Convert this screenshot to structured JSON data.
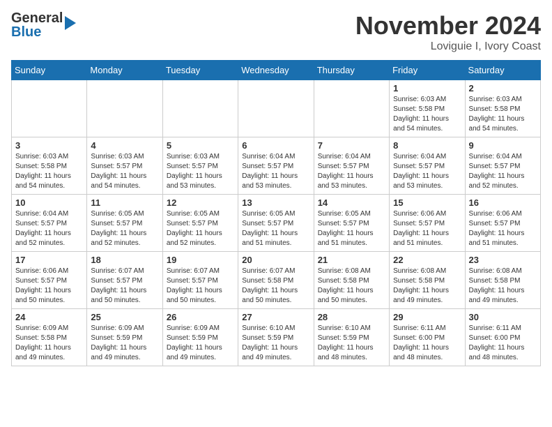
{
  "header": {
    "logo": {
      "line1": "General",
      "line2": "Blue"
    },
    "title": "November 2024",
    "location": "Loviguie I, Ivory Coast"
  },
  "calendar": {
    "days_of_week": [
      "Sunday",
      "Monday",
      "Tuesday",
      "Wednesday",
      "Thursday",
      "Friday",
      "Saturday"
    ],
    "weeks": [
      [
        {
          "day": "",
          "info": ""
        },
        {
          "day": "",
          "info": ""
        },
        {
          "day": "",
          "info": ""
        },
        {
          "day": "",
          "info": ""
        },
        {
          "day": "",
          "info": ""
        },
        {
          "day": "1",
          "info": "Sunrise: 6:03 AM\nSunset: 5:58 PM\nDaylight: 11 hours and 54 minutes."
        },
        {
          "day": "2",
          "info": "Sunrise: 6:03 AM\nSunset: 5:58 PM\nDaylight: 11 hours and 54 minutes."
        }
      ],
      [
        {
          "day": "3",
          "info": "Sunrise: 6:03 AM\nSunset: 5:58 PM\nDaylight: 11 hours and 54 minutes."
        },
        {
          "day": "4",
          "info": "Sunrise: 6:03 AM\nSunset: 5:57 PM\nDaylight: 11 hours and 54 minutes."
        },
        {
          "day": "5",
          "info": "Sunrise: 6:03 AM\nSunset: 5:57 PM\nDaylight: 11 hours and 53 minutes."
        },
        {
          "day": "6",
          "info": "Sunrise: 6:04 AM\nSunset: 5:57 PM\nDaylight: 11 hours and 53 minutes."
        },
        {
          "day": "7",
          "info": "Sunrise: 6:04 AM\nSunset: 5:57 PM\nDaylight: 11 hours and 53 minutes."
        },
        {
          "day": "8",
          "info": "Sunrise: 6:04 AM\nSunset: 5:57 PM\nDaylight: 11 hours and 53 minutes."
        },
        {
          "day": "9",
          "info": "Sunrise: 6:04 AM\nSunset: 5:57 PM\nDaylight: 11 hours and 52 minutes."
        }
      ],
      [
        {
          "day": "10",
          "info": "Sunrise: 6:04 AM\nSunset: 5:57 PM\nDaylight: 11 hours and 52 minutes."
        },
        {
          "day": "11",
          "info": "Sunrise: 6:05 AM\nSunset: 5:57 PM\nDaylight: 11 hours and 52 minutes."
        },
        {
          "day": "12",
          "info": "Sunrise: 6:05 AM\nSunset: 5:57 PM\nDaylight: 11 hours and 52 minutes."
        },
        {
          "day": "13",
          "info": "Sunrise: 6:05 AM\nSunset: 5:57 PM\nDaylight: 11 hours and 51 minutes."
        },
        {
          "day": "14",
          "info": "Sunrise: 6:05 AM\nSunset: 5:57 PM\nDaylight: 11 hours and 51 minutes."
        },
        {
          "day": "15",
          "info": "Sunrise: 6:06 AM\nSunset: 5:57 PM\nDaylight: 11 hours and 51 minutes."
        },
        {
          "day": "16",
          "info": "Sunrise: 6:06 AM\nSunset: 5:57 PM\nDaylight: 11 hours and 51 minutes."
        }
      ],
      [
        {
          "day": "17",
          "info": "Sunrise: 6:06 AM\nSunset: 5:57 PM\nDaylight: 11 hours and 50 minutes."
        },
        {
          "day": "18",
          "info": "Sunrise: 6:07 AM\nSunset: 5:57 PM\nDaylight: 11 hours and 50 minutes."
        },
        {
          "day": "19",
          "info": "Sunrise: 6:07 AM\nSunset: 5:57 PM\nDaylight: 11 hours and 50 minutes."
        },
        {
          "day": "20",
          "info": "Sunrise: 6:07 AM\nSunset: 5:58 PM\nDaylight: 11 hours and 50 minutes."
        },
        {
          "day": "21",
          "info": "Sunrise: 6:08 AM\nSunset: 5:58 PM\nDaylight: 11 hours and 50 minutes."
        },
        {
          "day": "22",
          "info": "Sunrise: 6:08 AM\nSunset: 5:58 PM\nDaylight: 11 hours and 49 minutes."
        },
        {
          "day": "23",
          "info": "Sunrise: 6:08 AM\nSunset: 5:58 PM\nDaylight: 11 hours and 49 minutes."
        }
      ],
      [
        {
          "day": "24",
          "info": "Sunrise: 6:09 AM\nSunset: 5:58 PM\nDaylight: 11 hours and 49 minutes."
        },
        {
          "day": "25",
          "info": "Sunrise: 6:09 AM\nSunset: 5:59 PM\nDaylight: 11 hours and 49 minutes."
        },
        {
          "day": "26",
          "info": "Sunrise: 6:09 AM\nSunset: 5:59 PM\nDaylight: 11 hours and 49 minutes."
        },
        {
          "day": "27",
          "info": "Sunrise: 6:10 AM\nSunset: 5:59 PM\nDaylight: 11 hours and 49 minutes."
        },
        {
          "day": "28",
          "info": "Sunrise: 6:10 AM\nSunset: 5:59 PM\nDaylight: 11 hours and 48 minutes."
        },
        {
          "day": "29",
          "info": "Sunrise: 6:11 AM\nSunset: 6:00 PM\nDaylight: 11 hours and 48 minutes."
        },
        {
          "day": "30",
          "info": "Sunrise: 6:11 AM\nSunset: 6:00 PM\nDaylight: 11 hours and 48 minutes."
        }
      ]
    ]
  }
}
